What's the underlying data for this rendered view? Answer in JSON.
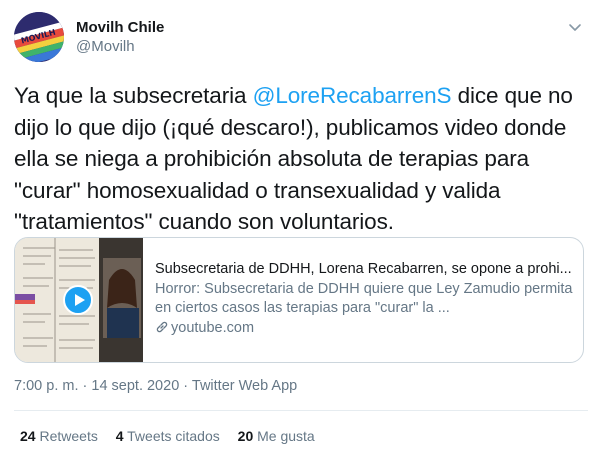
{
  "author": {
    "display_name": "Movilh Chile",
    "handle": "@Movilh",
    "avatar_text": "MOVILH"
  },
  "tweet": {
    "text_before": "Ya que la subsecretaria ",
    "mention": "@LoreRecabarrenS",
    "text_after": "  dice que no dijo lo que dijo (¡qué descaro!), publicamos video donde ella se niega a prohibición absoluta de terapias para \"curar\" homosexualidad o transexualidad y valida \"tratamientos\" cuando son voluntarios."
  },
  "card": {
    "title": "Subsecretaria de DDHH, Lorena Recabarren, se opone a prohi...",
    "description": "Horror: Subsecretaria de DDHH quiere que Ley Zamudio permita en ciertos casos las terapias para \"curar\" la ...",
    "domain": "youtube.com"
  },
  "meta": {
    "time": "7:00 p. m.",
    "separator1": " · ",
    "date": "14 sept. 2020",
    "separator2": " · ",
    "source": "Twitter Web App"
  },
  "stats": {
    "retweets_count": "24",
    "retweets_label": "Retweets",
    "quotes_count": "4",
    "quotes_label": "Tweets citados",
    "likes_count": "20",
    "likes_label": "Me gusta"
  },
  "colors": {
    "link": "#1da1f2",
    "secondary": "#657786",
    "border": "#ccd6dd"
  }
}
